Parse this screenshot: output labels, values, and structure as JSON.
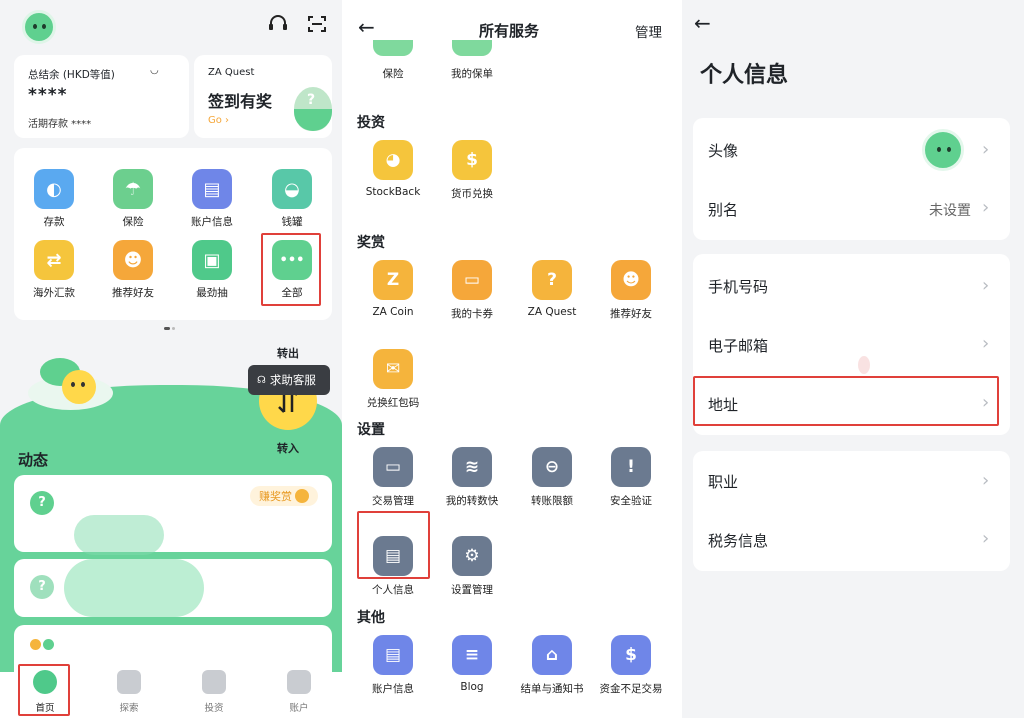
{
  "home": {
    "balance_label": "总结余 (HKD等值)",
    "balance_value": "****",
    "savings_label": "活期存款 ****",
    "quest_title": "ZA Quest",
    "quest_headline": "签到有奖",
    "quest_go": "Go ›",
    "services": [
      {
        "label": "存款"
      },
      {
        "label": "保险"
      },
      {
        "label": "账户信息"
      },
      {
        "label": "钱罐"
      },
      {
        "label": "海外汇款"
      },
      {
        "label": "推荐好友"
      },
      {
        "label": "最劲抽"
      },
      {
        "label": "全部"
      }
    ],
    "transfer_out": "转出",
    "transfer_in": "转入",
    "help_label": "求助客服",
    "activity_title": "动态",
    "reward_badge": "赚奖赏",
    "tabs": [
      {
        "label": "首页"
      },
      {
        "label": "探索"
      },
      {
        "label": "投资"
      },
      {
        "label": "账户"
      }
    ]
  },
  "services_page": {
    "title": "所有服务",
    "manage": "管理",
    "insurance_row": [
      {
        "label": "保险"
      },
      {
        "label": "我的保单"
      }
    ],
    "sections": [
      {
        "title": "投资",
        "items": [
          {
            "label": "StockBack"
          },
          {
            "label": "货币兑换"
          }
        ]
      },
      {
        "title": "奖赏",
        "items": [
          {
            "label": "ZA Coin"
          },
          {
            "label": "我的卡券"
          },
          {
            "label": "ZA Quest"
          },
          {
            "label": "推荐好友"
          },
          {
            "label": "兑换红包码"
          }
        ]
      },
      {
        "title": "设置",
        "items": [
          {
            "label": "交易管理"
          },
          {
            "label": "我的转数快"
          },
          {
            "label": "转账限额"
          },
          {
            "label": "安全验证"
          },
          {
            "label": "个人信息"
          },
          {
            "label": "设置管理"
          }
        ]
      },
      {
        "title": "其他",
        "items": [
          {
            "label": "账户信息"
          },
          {
            "label": "Blog"
          },
          {
            "label": "结单与通知书"
          },
          {
            "label": "资金不足交易"
          }
        ]
      }
    ]
  },
  "profile": {
    "title": "个人信息",
    "avatar_label": "头像",
    "nickname_label": "别名",
    "nickname_value": "未设置",
    "phone_label": "手机号码",
    "email_label": "电子邮箱",
    "address_label": "地址",
    "job_label": "职业",
    "tax_label": "税务信息"
  },
  "colors": {
    "brand_green": "#5fd08f",
    "accent_orange": "#f5a73a",
    "highlight_red": "#e0403a"
  }
}
